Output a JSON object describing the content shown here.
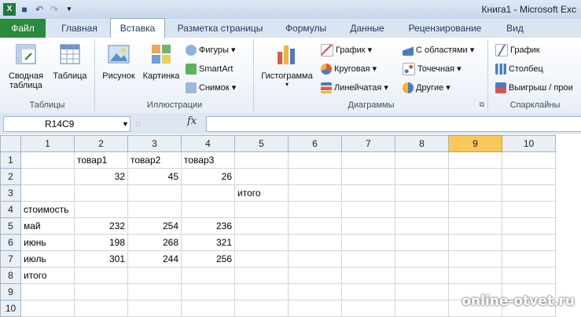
{
  "window": {
    "title": "Книга1 - Microsoft Exc"
  },
  "tabs": [
    "Файл",
    "Главная",
    "Вставка",
    "Разметка страницы",
    "Формулы",
    "Данные",
    "Рецензирование",
    "Вид"
  ],
  "active_tab": "Вставка",
  "ribbon": {
    "tables": {
      "label": "Таблицы",
      "pivot_line1": "Сводная",
      "pivot_line2": "таблица",
      "table": "Таблица"
    },
    "illustrations": {
      "label": "Иллюстрации",
      "picture": "Рисунок",
      "clipart": "Картинка",
      "shapes": "Фигуры",
      "smartart": "SmartArt",
      "screenshot": "Снимок"
    },
    "charts": {
      "label": "Диаграммы",
      "histogram": "Гистограмма",
      "line": "График",
      "pie": "Круговая",
      "bar": "Линейчатая",
      "area": "С областями",
      "scatter": "Точечная",
      "other": "Другие"
    },
    "sparklines": {
      "label": "Спарклайны",
      "line": "График",
      "column": "Столбец",
      "winloss": "Выигрыш / прои"
    }
  },
  "formula_bar": {
    "name_box": "R14C9",
    "fx": "fx",
    "formula": ""
  },
  "grid": {
    "columns": [
      "1",
      "2",
      "3",
      "4",
      "5",
      "6",
      "7",
      "8",
      "9",
      "10"
    ],
    "selected_column": "9",
    "rows": [
      {
        "n": "1",
        "cells": [
          "",
          "товар1",
          "товар2",
          "товар3",
          "",
          "",
          "",
          "",
          "",
          ""
        ]
      },
      {
        "n": "2",
        "cells": [
          "",
          "32",
          "45",
          "26",
          "",
          "",
          "",
          "",
          "",
          ""
        ]
      },
      {
        "n": "3",
        "cells": [
          "",
          "",
          "",
          "",
          "итого",
          "",
          "",
          "",
          "",
          ""
        ]
      },
      {
        "n": "4",
        "cells": [
          "стоимость",
          "",
          "",
          "",
          "",
          "",
          "",
          "",
          "",
          ""
        ]
      },
      {
        "n": "5",
        "cells": [
          "май",
          "232",
          "254",
          "236",
          "",
          "",
          "",
          "",
          "",
          ""
        ]
      },
      {
        "n": "6",
        "cells": [
          "июнь",
          "198",
          "268",
          "321",
          "",
          "",
          "",
          "",
          "",
          ""
        ]
      },
      {
        "n": "7",
        "cells": [
          "июль",
          "301",
          "244",
          "256",
          "",
          "",
          "",
          "",
          "",
          ""
        ]
      },
      {
        "n": "8",
        "cells": [
          "итого",
          "",
          "",
          "",
          "",
          "",
          "",
          "",
          "",
          ""
        ]
      },
      {
        "n": "9",
        "cells": [
          "",
          "",
          "",
          "",
          "",
          "",
          "",
          "",
          "",
          ""
        ]
      },
      {
        "n": "10",
        "cells": [
          "",
          "",
          "",
          "",
          "",
          "",
          "",
          "",
          "",
          ""
        ]
      }
    ]
  },
  "watermark": "online-otvet.ru"
}
